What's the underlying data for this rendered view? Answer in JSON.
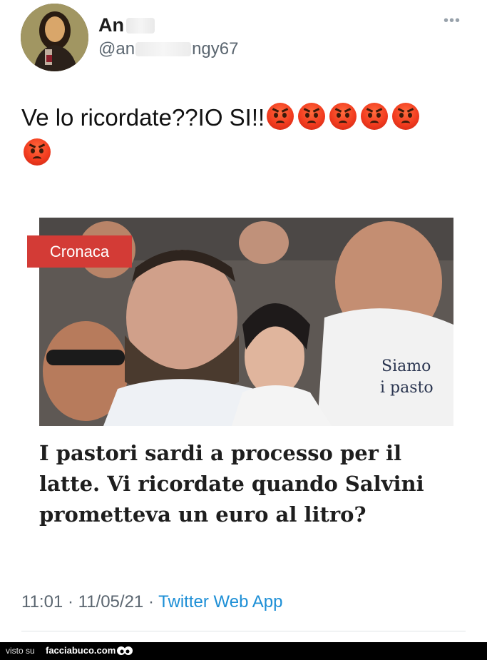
{
  "author": {
    "display_name_visible": "An",
    "handle_prefix": "@an",
    "handle_suffix": "ngy67",
    "avatar": "mona-lisa-avatar"
  },
  "more_icon": "more-horizontal-icon",
  "tweet": {
    "text": "Ve lo ricordate??IO SI!!",
    "emoji": "angry-face-emoji",
    "emoji_count": 6
  },
  "card": {
    "category": "Cronaca",
    "headline": "I pastori sardi a processo per il latte. Vi ricordate quando Salvini prometteva un euro al litro?",
    "photo": "group-selfie-photo"
  },
  "meta": {
    "time": "11:01",
    "separator": "·",
    "date": "11/05/21",
    "source": "Twitter Web App"
  },
  "footer": {
    "label": "visto su",
    "site": "facciabuco.com"
  },
  "colors": {
    "badge": "#d33b36",
    "source_link": "#1d8fd6",
    "muted": "#5b6670"
  }
}
